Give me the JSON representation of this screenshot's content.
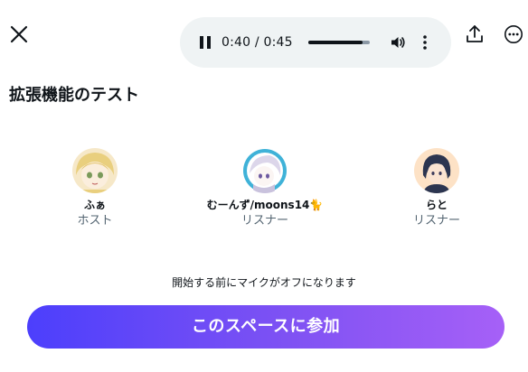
{
  "header": {
    "close_icon": "close-icon",
    "share_icon": "share-icon",
    "more_icon": "more-options-icon"
  },
  "player": {
    "state_icon": "pause-icon",
    "current_time": "0:40",
    "duration": "0:45",
    "time_display": "0:40 / 0:45",
    "progress": 0.889,
    "volume_icon": "volume-icon",
    "more_icon": "vertical-dots-icon"
  },
  "space": {
    "title": "拡張機能のテスト"
  },
  "participants": [
    {
      "name": "ふぁ",
      "role": "ホスト"
    },
    {
      "name": "むーんず/moons14🐈",
      "role": "リスナー"
    },
    {
      "name": "らと",
      "role": "リスナー"
    }
  ],
  "notice": "開始する前にマイクがオフになります",
  "join_button": {
    "label": "このスペースに参加"
  },
  "colors": {
    "join_gradient_start": "#4c3ffc",
    "join_gradient_end": "#a660f7",
    "player_bg": "#eff3f4",
    "secondary_text": "#536471"
  }
}
